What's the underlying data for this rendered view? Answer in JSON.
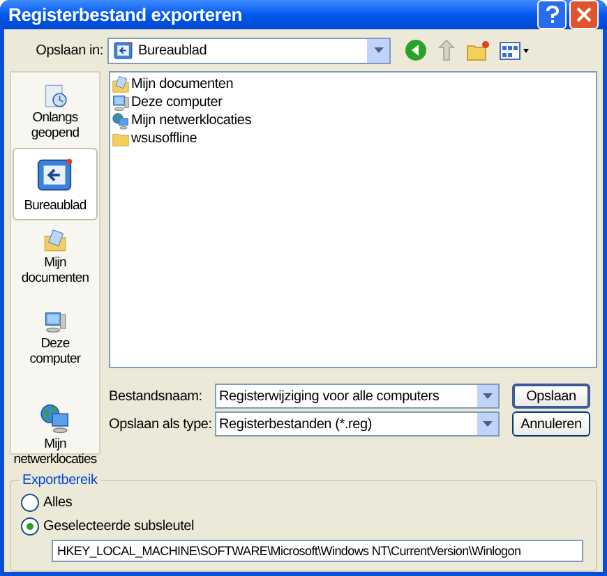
{
  "window": {
    "title": "Registerbestand exporteren"
  },
  "save_in": {
    "label": "Opslaan in:",
    "value": "Bureaublad"
  },
  "places": [
    {
      "label": "Onlangs geopend",
      "kind": "recent",
      "selected": false
    },
    {
      "label": "Bureaublad",
      "kind": "desktop",
      "selected": true
    },
    {
      "label": "Mijn documenten",
      "kind": "documents",
      "selected": false
    },
    {
      "label": "Deze computer",
      "kind": "computer",
      "selected": false
    },
    {
      "label": "Mijn netwerklocaties",
      "kind": "network",
      "selected": false
    }
  ],
  "files": [
    {
      "name": "Mijn documenten",
      "kind": "documents"
    },
    {
      "name": "Deze computer",
      "kind": "computer"
    },
    {
      "name": "Mijn netwerklocaties",
      "kind": "network"
    },
    {
      "name": "wsusoffline",
      "kind": "folder"
    }
  ],
  "file_name": {
    "label": "Bestandsnaam:",
    "value": "Registerwijziging voor alle computers"
  },
  "file_type": {
    "label": "Opslaan als type:",
    "value": "Registerbestanden (*.reg)"
  },
  "buttons": [
    "Opslaan",
    "Annuleren"
  ],
  "export_range": {
    "title": "Exportbereik",
    "options": [
      {
        "label": "Alles",
        "selected": false
      },
      {
        "label": "Geselecteerde subsleutel",
        "selected": true
      }
    ],
    "key_path": "HKEY_LOCAL_MACHINE\\SOFTWARE\\Microsoft\\Windows NT\\CurrentVersion\\Winlogon"
  }
}
